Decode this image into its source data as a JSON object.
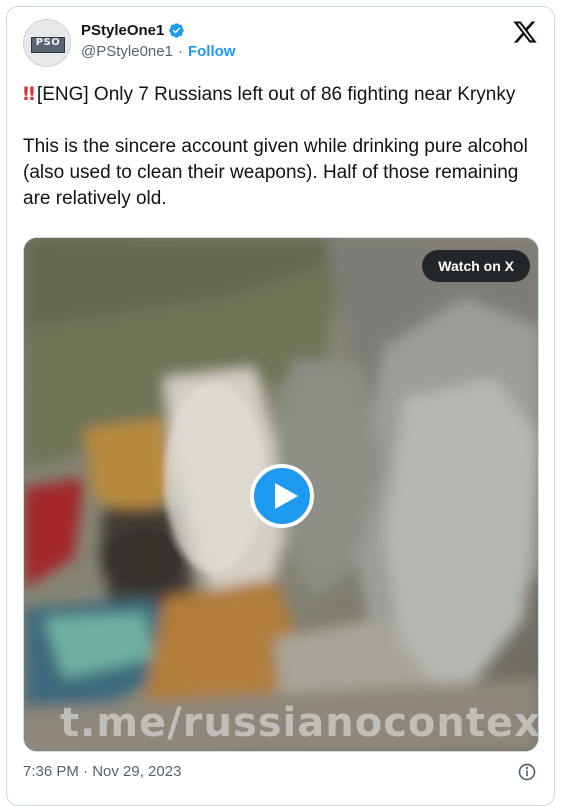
{
  "tweet": {
    "author_name": "PStyleOne1",
    "handle": "@PStyle0ne1",
    "separator": "·",
    "follow_label": "Follow",
    "avatar_logo_text": "PSO",
    "text_line1": "[ENG] Only 7 Russians left out of 86 fighting near Krynky",
    "text_line2": "This is the sincere account given while drinking pure alcohol (also used to clean their weapons). Half of those remaining are relatively old.",
    "emoji": "‼",
    "timestamp": "7:36 PM · Nov 29, 2023"
  },
  "media": {
    "watch_label": "Watch on X",
    "watermark": "t.me/russianocontext"
  },
  "icons": {
    "verified": "verified-badge-icon",
    "x_logo": "x-logo-icon",
    "play": "play-icon",
    "info": "info-icon"
  },
  "colors": {
    "accent": "#1d9bf0",
    "text": "#0f1419",
    "secondary": "#536471",
    "emoji_red": "#e0303a"
  }
}
